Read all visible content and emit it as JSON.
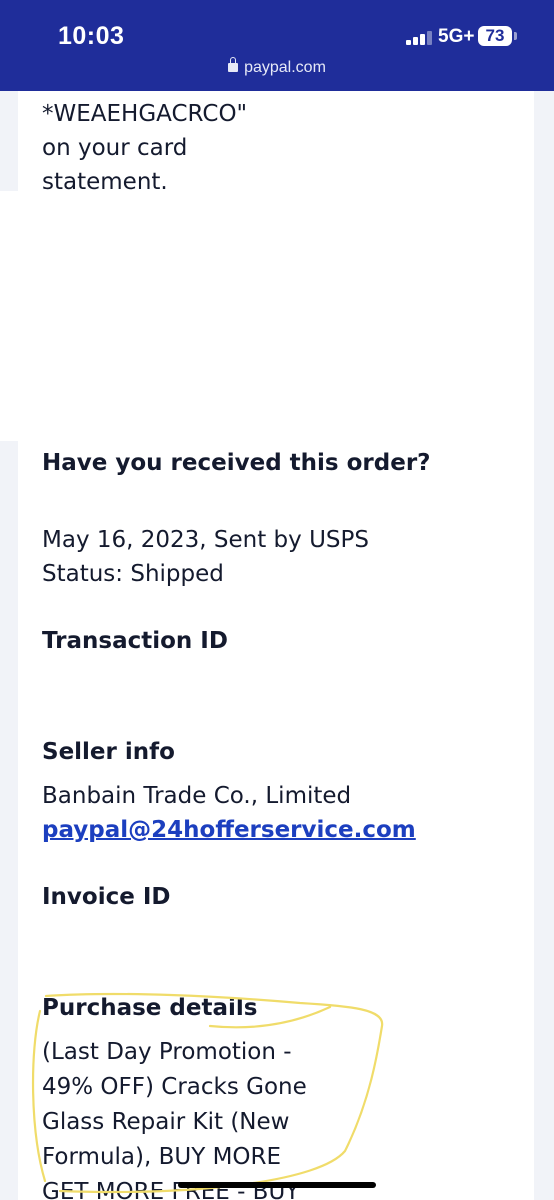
{
  "status_bar": {
    "time": "10:03",
    "network": "5G+",
    "battery": "73"
  },
  "browser": {
    "url": "paypal.com"
  },
  "statement": {
    "line1": "*WEAEHGACRCO\"",
    "line2": "on your card",
    "line3": "statement."
  },
  "order": {
    "question": "Have you received this order?",
    "shipping_line": "May 16, 2023, Sent by USPS",
    "status_line": "Status: Shipped"
  },
  "transaction": {
    "label": "Transaction ID"
  },
  "seller": {
    "label": "Seller info",
    "name": "Banbain Trade Co., Limited",
    "email": "paypal@24hofferservice.com"
  },
  "invoice": {
    "label": "Invoice ID"
  },
  "purchase": {
    "label": "Purchase details",
    "lines": [
      "(Last Day Promotion -",
      "49% OFF) Cracks Gone",
      "Glass Repair Kit (New",
      "Formula), BUY MORE",
      "GET MORE FREE - BUY"
    ]
  },
  "colors": {
    "status_bar_bg": "#1f2d9a",
    "link": "#1c3fbf",
    "highlight_scribble": "#f0dc6a"
  }
}
